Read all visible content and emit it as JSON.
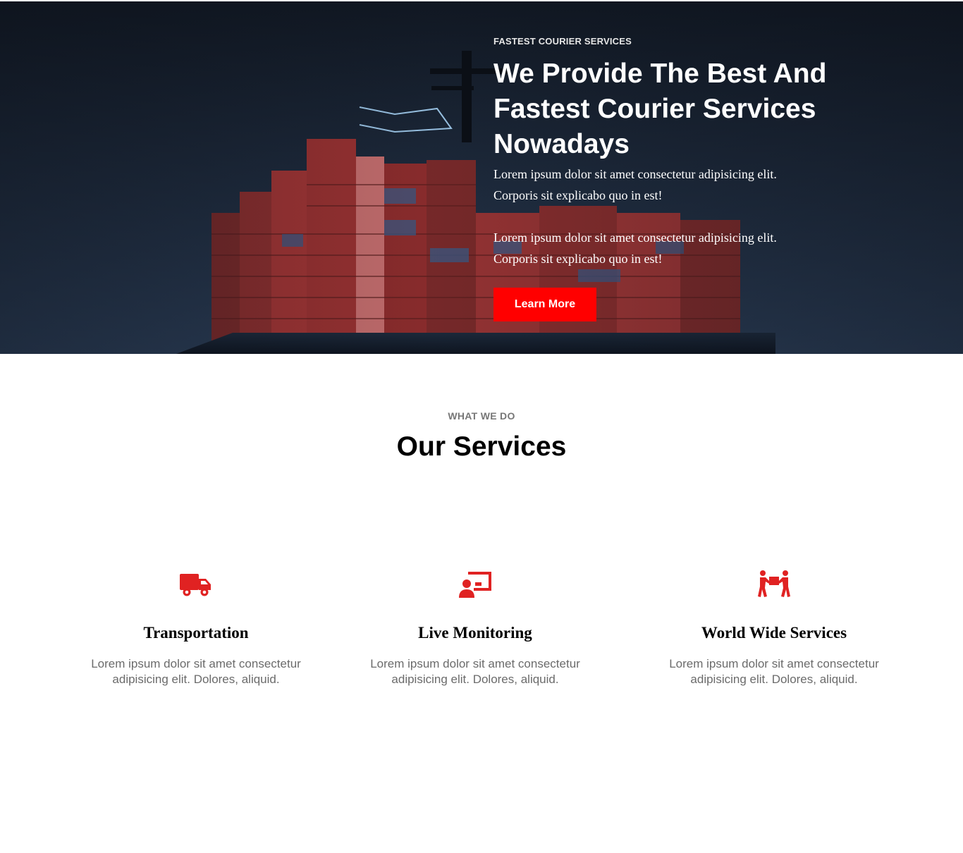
{
  "hero": {
    "eyebrow": "FASTEST COURIER SERVICES",
    "title": "We Provide The Best And Fastest Courier Services Nowadays",
    "paragraph_1": "Lorem ipsum dolor sit amet consectetur adipisicing elit. Corporis sit explicabo quo in est!",
    "paragraph_2": "Lorem ipsum dolor sit amet consectetur adipisicing elit. Corporis sit explicabo quo in est!",
    "cta_label": "Learn More",
    "accent_color": "#ff0000"
  },
  "services": {
    "kicker": "WHAT WE DO",
    "title": "Our Services",
    "items": [
      {
        "icon": "truck-icon",
        "title": "Transportation",
        "text": "Lorem ipsum dolor sit amet consectetur adipisicing elit. Dolores, aliquid."
      },
      {
        "icon": "presenter-monitor-icon",
        "title": "Live Monitoring",
        "text": "Lorem ipsum dolor sit amet consectetur adipisicing elit. Dolores, aliquid."
      },
      {
        "icon": "people-carry-box-icon",
        "title": "World Wide Services",
        "text": "Lorem ipsum dolor sit amet consectetur adipisicing elit. Dolores, aliquid."
      }
    ],
    "icon_color": "#e02222"
  }
}
